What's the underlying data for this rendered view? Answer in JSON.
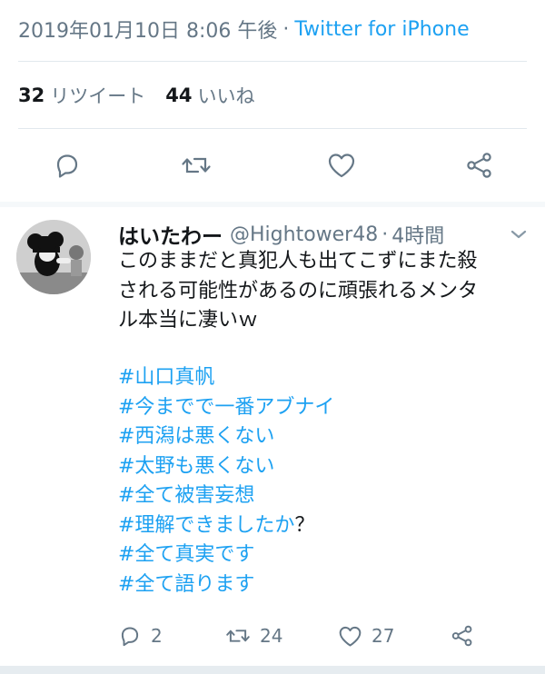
{
  "tweet": {
    "timestamp": "2019年01月10日 8:06 午後",
    "separator": "·",
    "source": "Twitter for iPhone",
    "retweets_count": "32",
    "retweets_label": "リツイート",
    "likes_count": "44",
    "likes_label": "いいね"
  },
  "reply": {
    "display_name": "はいたわー",
    "handle": "@Hightower48",
    "separator": "·",
    "time": "4時間",
    "text_lines": [
      "このままだと真犯人も出てこずにまた殺",
      "される可能性があるのに頑張れるメンタ",
      "ル本当に凄いｗ"
    ],
    "hashtags": [
      {
        "tag": "#山口真帆",
        "suffix": ""
      },
      {
        "tag": "#今までで一番アブナイ",
        "suffix": ""
      },
      {
        "tag": "#西潟は悪くない",
        "suffix": ""
      },
      {
        "tag": "#太野も悪くない",
        "suffix": ""
      },
      {
        "tag": "#全て被害妄想",
        "suffix": ""
      },
      {
        "tag": "#理解できましたか",
        "suffix": "？"
      },
      {
        "tag": "#全て真実です",
        "suffix": ""
      },
      {
        "tag": "#全て語ります",
        "suffix": ""
      }
    ],
    "reply_count": "2",
    "retweet_count": "24",
    "like_count": "27"
  },
  "icons": {
    "reply": "reply-icon",
    "retweet": "retweet-icon",
    "like": "heart-icon",
    "share": "share-icon",
    "caret": "chevron-down-icon"
  },
  "colors": {
    "link": "#1da1f2",
    "muted": "#657786",
    "text": "#14171a"
  }
}
